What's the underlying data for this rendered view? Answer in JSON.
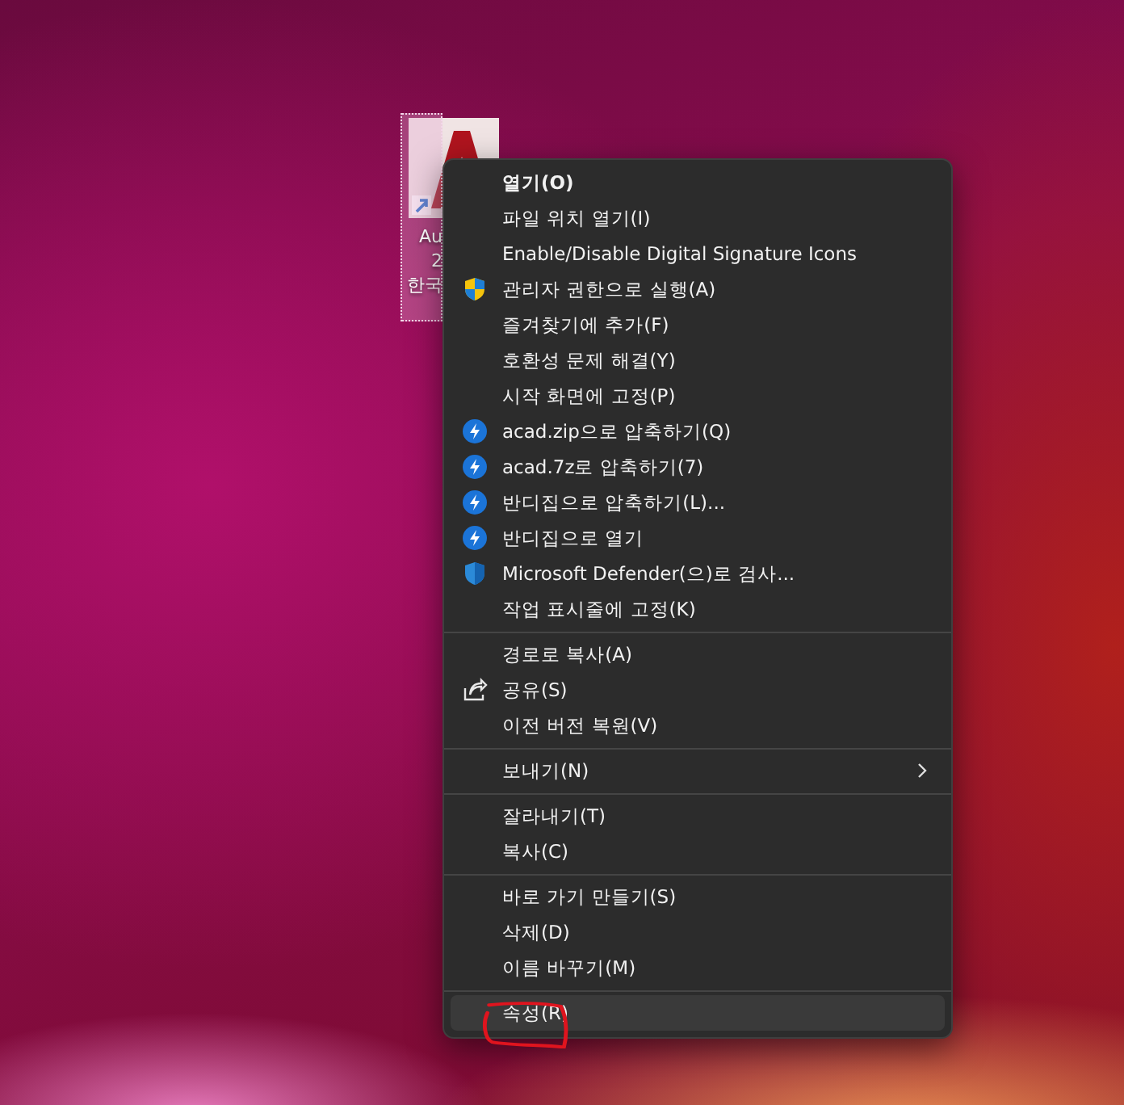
{
  "desktop_icon": {
    "selected": true,
    "label_lines": [
      "Au",
      "2",
      "한국"
    ]
  },
  "context_menu": {
    "groups": [
      {
        "items": [
          {
            "label": "열기(O)",
            "kind": "plain",
            "default": true,
            "selected": false
          },
          {
            "label": "파일 위치 열기(I)",
            "kind": "plain",
            "default": false,
            "selected": false
          },
          {
            "label": "Enable/Disable Digital Signature Icons",
            "kind": "plain",
            "default": false,
            "selected": false
          },
          {
            "label": "관리자 권한으로 실행(A)",
            "kind": "shield",
            "default": false,
            "selected": false
          },
          {
            "label": "즐겨찾기에 추가(F)",
            "kind": "plain",
            "default": false,
            "selected": false
          },
          {
            "label": "호환성 문제 해결(Y)",
            "kind": "plain",
            "default": false,
            "selected": false
          },
          {
            "label": "시작 화면에 고정(P)",
            "kind": "plain",
            "default": false,
            "selected": false
          },
          {
            "label": "acad.zip으로 압축하기(Q)",
            "kind": "archiver",
            "default": false,
            "selected": false
          },
          {
            "label": "acad.7z로 압축하기(7)",
            "kind": "archiver",
            "default": false,
            "selected": false
          },
          {
            "label": "반디집으로 압축하기(L)...",
            "kind": "archiver",
            "default": false,
            "selected": false
          },
          {
            "label": "반디집으로 열기",
            "kind": "archiver",
            "default": false,
            "selected": false
          },
          {
            "label": "Microsoft Defender(으)로 검사...",
            "kind": "defender",
            "default": false,
            "selected": false
          },
          {
            "label": "작업 표시줄에 고정(K)",
            "kind": "plain",
            "default": false,
            "selected": false
          }
        ]
      },
      {
        "items": [
          {
            "label": "경로로 복사(A)",
            "kind": "plain",
            "default": false,
            "selected": false
          },
          {
            "label": "공유(S)",
            "kind": "share",
            "default": false,
            "selected": false
          },
          {
            "label": "이전 버전 복원(V)",
            "kind": "plain",
            "default": false,
            "selected": false
          }
        ]
      },
      {
        "items": [
          {
            "label": "보내기(N)",
            "kind": "submenu",
            "default": false,
            "selected": false
          }
        ]
      },
      {
        "items": [
          {
            "label": "잘라내기(T)",
            "kind": "plain",
            "default": false,
            "selected": false
          },
          {
            "label": "복사(C)",
            "kind": "plain",
            "default": false,
            "selected": false
          }
        ]
      },
      {
        "items": [
          {
            "label": "바로 가기 만들기(S)",
            "kind": "plain",
            "default": false,
            "selected": false
          },
          {
            "label": "삭제(D)",
            "kind": "plain",
            "default": false,
            "selected": false
          },
          {
            "label": "이름 바꾸기(M)",
            "kind": "plain",
            "default": false,
            "selected": false
          }
        ]
      },
      {
        "items": [
          {
            "label": "속성(R)",
            "kind": "plain",
            "default": false,
            "selected": true
          }
        ]
      }
    ]
  }
}
